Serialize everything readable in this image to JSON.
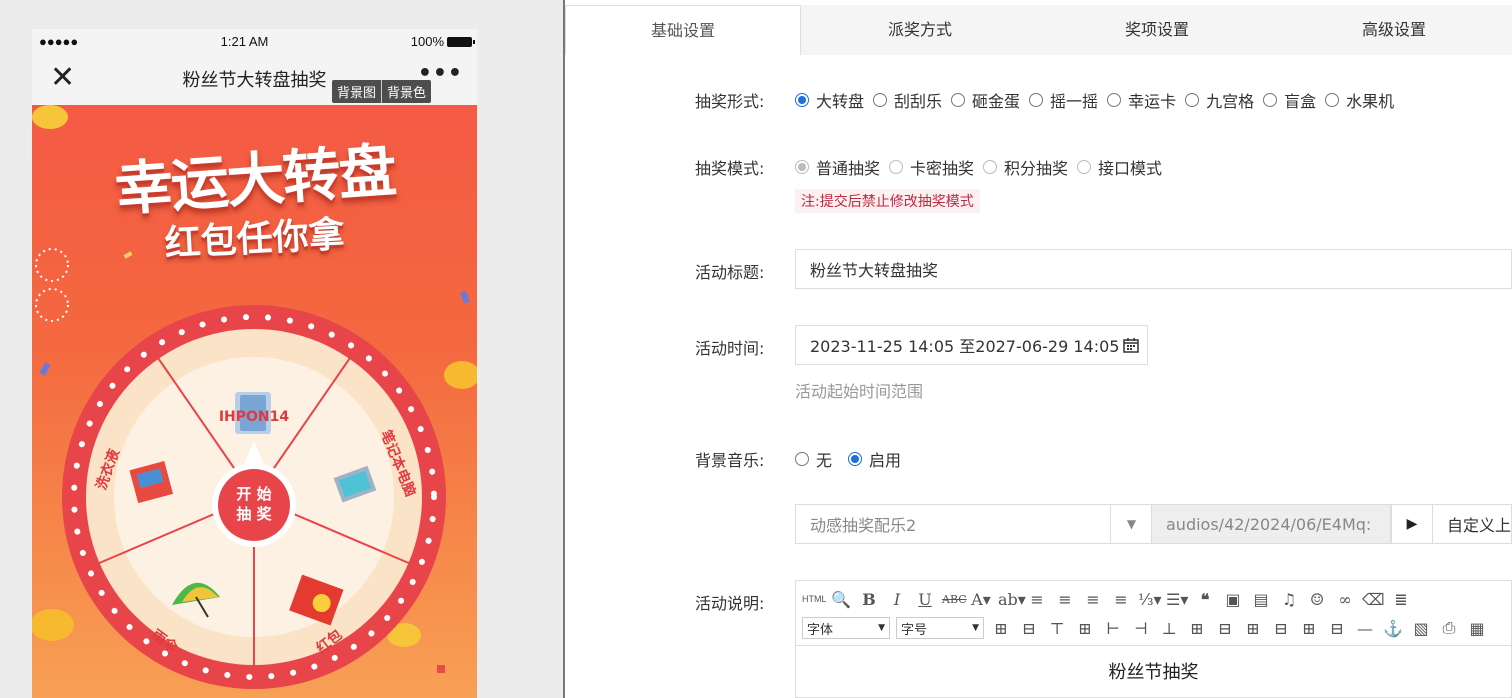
{
  "phone": {
    "status": {
      "signal": "●●●●●",
      "time": "1:21 AM",
      "battery": "100%"
    },
    "nav": {
      "title": "粉丝节大转盘抽奖",
      "more": "•••"
    },
    "bg_tabs": [
      "背景图",
      "背景色"
    ],
    "banner": {
      "title": "幸运大转盘",
      "subtitle": "红包任你拿"
    },
    "wheel": {
      "center_line1": "开 始",
      "center_line2": "抽 奖",
      "prizes": [
        "IHPON14",
        "笔记本电脑",
        "红包",
        "雨伞",
        "洗衣液"
      ]
    }
  },
  "tabs": [
    "基础设置",
    "派奖方式",
    "奖项设置",
    "高级设置"
  ],
  "form": {
    "lottery_form": {
      "label": "抽奖形式:",
      "options": [
        "大转盘",
        "刮刮乐",
        "砸金蛋",
        "摇一摇",
        "幸运卡",
        "九宫格",
        "盲盒",
        "水果机"
      ],
      "selected": "大转盘"
    },
    "lottery_mode": {
      "label": "抽奖模式:",
      "options": [
        "普通抽奖",
        "卡密抽奖",
        "积分抽奖",
        "接口模式"
      ],
      "selected": "普通抽奖",
      "note": "注:提交后禁止修改抽奖模式"
    },
    "title": {
      "label": "活动标题:",
      "value": "粉丝节大转盘抽奖"
    },
    "time": {
      "label": "活动时间:",
      "value": "2023-11-25 14:05 至2027-06-29 14:05",
      "hint": "活动起始时间范围"
    },
    "music": {
      "label": "背景音乐:",
      "options": [
        "无",
        "启用"
      ],
      "selected": "启用",
      "track": "动感抽奖配乐2",
      "path": "audios/42/2024/06/E4Mq:",
      "custom_btn": "自定义上"
    },
    "desc": {
      "label": "活动说明:",
      "font_select": "字体",
      "size_select": "字号",
      "content": "粉丝节抽奖"
    }
  },
  "colors": {
    "accent": "#1e6fe0",
    "stage_top": "#f45a44",
    "wheel_rim": "#e8454a",
    "note_text": "#c0293f"
  }
}
